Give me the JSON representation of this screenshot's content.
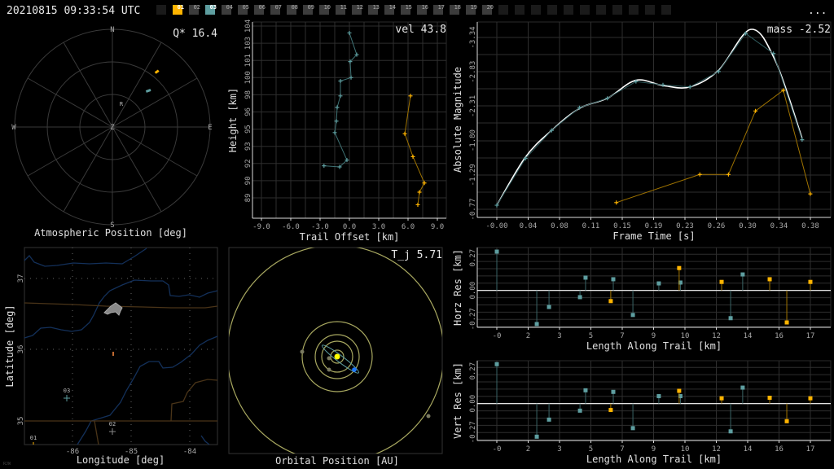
{
  "header": {
    "timestamp": "20210815 09:33:54 UTC",
    "menu_label": "...",
    "leading_blank_tabs": 1,
    "trailing_blank_tabs": 11,
    "tabs": [
      {
        "label": "01",
        "state": "orange"
      },
      {
        "label": "02",
        "state": "off"
      },
      {
        "label": "03",
        "state": "teal"
      },
      {
        "label": "04",
        "state": "off"
      },
      {
        "label": "05",
        "state": "off"
      },
      {
        "label": "06",
        "state": "off"
      },
      {
        "label": "07",
        "state": "off"
      },
      {
        "label": "08",
        "state": "off"
      },
      {
        "label": "09",
        "state": "off"
      },
      {
        "label": "10",
        "state": "off"
      },
      {
        "label": "11",
        "state": "off"
      },
      {
        "label": "12",
        "state": "off"
      },
      {
        "label": "13",
        "state": "off"
      },
      {
        "label": "14",
        "state": "off"
      },
      {
        "label": "15",
        "state": "off"
      },
      {
        "label": "16",
        "state": "off"
      },
      {
        "label": "17",
        "state": "off"
      },
      {
        "label": "18",
        "state": "off"
      },
      {
        "label": "19",
        "state": "off"
      },
      {
        "label": "20",
        "state": "off"
      }
    ]
  },
  "colors": {
    "teal": "#5e9ea0",
    "orange": "#ffb400",
    "white": "#ffffff",
    "grid": "#2e2e2e",
    "blue": "#1e90ff",
    "river": "#13305a",
    "border": "#4a3418"
  },
  "polar": {
    "title": "Atmospheric Position [deg]",
    "stat": "Q* 16.4",
    "labels": {
      "n": "N",
      "e": "E",
      "s": "S",
      "w": "W",
      "zenith": "Z",
      "radiant": "R"
    }
  },
  "map": {
    "xlabel": "Longitude [deg]",
    "ylabel": "Latitude [deg]",
    "xticks": [
      "-86",
      "-85",
      "-84"
    ],
    "yticks": [
      "37",
      "36",
      "35"
    ],
    "stations": [
      {
        "label": "03",
        "color": "teal"
      },
      {
        "label": "02",
        "color": "gray"
      },
      {
        "label": "01",
        "color": "orange"
      }
    ],
    "corner_logo": "RJW"
  },
  "orbit": {
    "title": "Orbital Position [AU]",
    "stat": "T_j 5.71"
  },
  "chart_data": [
    {
      "type": "line",
      "id": "trail",
      "title": "vel 43.8",
      "xlabel": "Trail Offset [km]",
      "ylabel": "Height [km]",
      "xlim": [
        -9.9,
        9.9
      ],
      "ylim": [
        88.0,
        104.0
      ],
      "xticks": [
        "-9.0",
        "-6.0",
        "-3.0",
        "0.0",
        "3.0",
        "6.0",
        "9.0"
      ],
      "yticks": [
        "104",
        "103",
        "101",
        "100",
        "98",
        "96",
        "95",
        "93",
        "92",
        "90",
        "89"
      ],
      "series": [
        {
          "name": "station-03",
          "color": "teal",
          "points": [
            [
              0,
              103.4
            ],
            [
              0.75,
              101.5
            ],
            [
              0.08,
              100.9
            ],
            [
              0.17,
              99.5
            ],
            [
              -0.92,
              99.2
            ],
            [
              -0.92,
              97.9
            ],
            [
              -1.25,
              96.9
            ],
            [
              -1.33,
              95.7
            ],
            [
              -1.5,
              94.7
            ],
            [
              -0.25,
              92.3
            ],
            [
              -1.0,
              91.7
            ],
            [
              -2.6,
              91.8
            ]
          ]
        },
        {
          "name": "station-01",
          "color": "orange",
          "points": [
            [
              6.25,
              97.9
            ],
            [
              5.67,
              94.6
            ],
            [
              6.5,
              92.6
            ],
            [
              7.67,
              90.3
            ],
            [
              7.17,
              89.5
            ],
            [
              7.0,
              88.4
            ]
          ]
        }
      ]
    },
    {
      "type": "line",
      "id": "lightcurve",
      "title": "mass -2.52",
      "xlabel": "Frame Time [s]",
      "ylabel": "Absolute Magnitude",
      "xticks": [
        "-0.00",
        "0.04",
        "0.08",
        "0.11",
        "0.15",
        "0.19",
        "0.23",
        "0.26",
        "0.30",
        "0.34",
        "0.38"
      ],
      "yticks": [
        "-3.34",
        "-2.83",
        "-2.31",
        "-1.80",
        "-1.29",
        "-0.77"
      ],
      "series": [
        {
          "name": "fit",
          "color": "white",
          "points": [
            [
              0,
              -0.83
            ],
            [
              0.035,
              -1.55
            ],
            [
              0.067,
              -1.95
            ],
            [
              0.101,
              -2.28
            ],
            [
              0.135,
              -2.43
            ],
            [
              0.17,
              -2.7
            ],
            [
              0.203,
              -2.62
            ],
            [
              0.236,
              -2.6
            ],
            [
              0.271,
              -2.85
            ],
            [
              0.31,
              -3.46
            ],
            [
              0.34,
              -3.0
            ],
            [
              0.373,
              -1.83
            ]
          ]
        },
        {
          "name": "station-03",
          "color": "teal",
          "points": [
            [
              0,
              -0.83
            ],
            [
              0.035,
              -1.53
            ],
            [
              0.067,
              -1.95
            ],
            [
              0.101,
              -2.29
            ],
            [
              0.135,
              -2.43
            ],
            [
              0.17,
              -2.68
            ],
            [
              0.203,
              -2.63
            ],
            [
              0.236,
              -2.6
            ],
            [
              0.271,
              -2.83
            ],
            [
              0.304,
              -3.4
            ],
            [
              0.338,
              -3.1
            ],
            [
              0.373,
              -1.81
            ]
          ]
        },
        {
          "name": "station-01",
          "color": "orange",
          "points": [
            [
              0.146,
              -0.87
            ],
            [
              0.248,
              -1.29
            ],
            [
              0.283,
              -1.29
            ],
            [
              0.316,
              -2.24
            ],
            [
              0.35,
              -2.55
            ],
            [
              0.383,
              -1.0
            ]
          ]
        }
      ]
    },
    {
      "type": "scatter",
      "id": "horz",
      "xlabel": "Length Along Trail [km]",
      "ylabel": "Horz Res [km]",
      "xticks": [
        "-0",
        "2",
        "3",
        "5",
        "7",
        "9",
        "10",
        "12",
        "14",
        "16",
        "17"
      ],
      "yticks": [
        "0.27",
        "0.00",
        "-0.27"
      ],
      "series": [
        {
          "name": "station-03",
          "color": "teal",
          "points": [
            [
              0,
              0.364
            ],
            [
              2.22,
              -0.315
            ],
            [
              2.9,
              -0.155
            ],
            [
              4.62,
              -0.063
            ],
            [
              4.93,
              0.12
            ],
            [
              6.47,
              0.105
            ],
            [
              7.56,
              -0.23
            ],
            [
              9.0,
              0.066
            ],
            [
              10.2,
              0.074
            ],
            [
              12.99,
              -0.26
            ],
            [
              13.66,
              0.15
            ]
          ]
        },
        {
          "name": "station-01",
          "color": "orange",
          "points": [
            [
              6.33,
              -0.1
            ],
            [
              10.13,
              0.21
            ],
            [
              12.49,
              0.08
            ],
            [
              15.16,
              0.105
            ],
            [
              16.11,
              -0.3
            ],
            [
              17.42,
              0.08
            ]
          ]
        }
      ]
    },
    {
      "type": "scatter",
      "id": "vert",
      "xlabel": "Length Along Trail [km]",
      "ylabel": "Vert Res [km]",
      "xticks": [
        "-0",
        "2",
        "3",
        "5",
        "7",
        "9",
        "10",
        "12",
        "14",
        "16",
        "17"
      ],
      "yticks": [
        "0.27",
        "0.00",
        "-0.27"
      ],
      "series": [
        {
          "name": "station-03",
          "color": "teal",
          "points": [
            [
              0,
              0.37
            ],
            [
              2.22,
              -0.31
            ],
            [
              2.9,
              -0.15
            ],
            [
              4.62,
              -0.066
            ],
            [
              4.93,
              0.125
            ],
            [
              6.47,
              0.11
            ],
            [
              7.56,
              -0.23
            ],
            [
              9.0,
              0.07
            ],
            [
              10.2,
              0.07
            ],
            [
              12.99,
              -0.26
            ],
            [
              13.66,
              0.15
            ]
          ]
        },
        {
          "name": "station-01",
          "color": "orange",
          "points": [
            [
              6.33,
              -0.06
            ],
            [
              10.13,
              0.12
            ],
            [
              12.49,
              0.05
            ],
            [
              15.16,
              0.055
            ],
            [
              16.11,
              -0.165
            ],
            [
              17.42,
              0.05
            ]
          ]
        }
      ]
    }
  ]
}
